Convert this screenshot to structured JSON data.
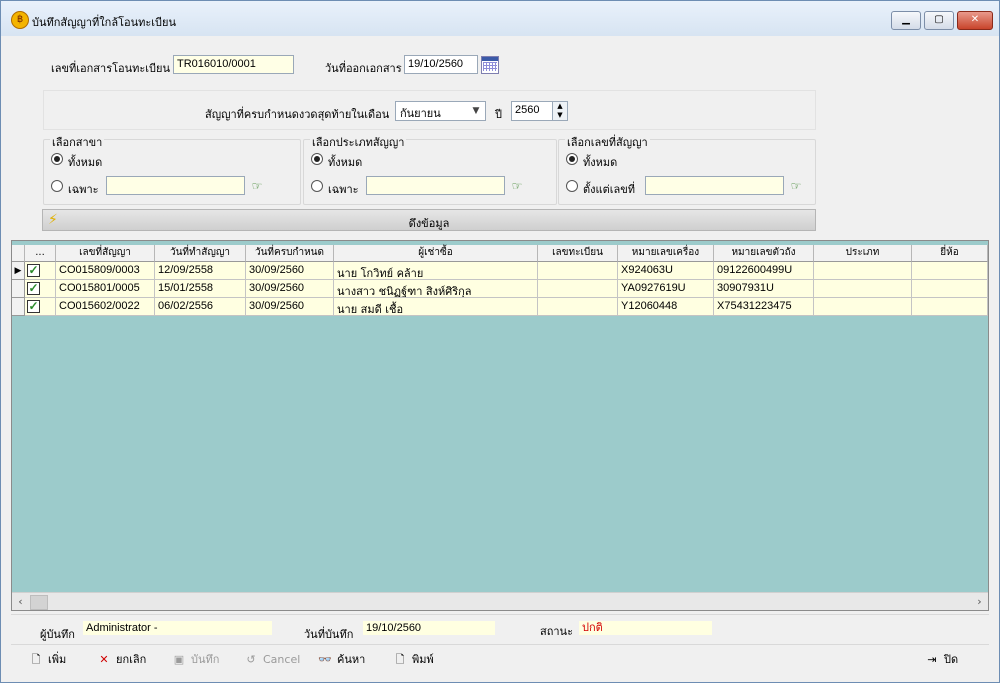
{
  "window": {
    "title": "บันทึกสัญญาที่ใกล้โอนทะเบียน"
  },
  "form": {
    "doc_no_label": "เลขที่เอกสารโอนทะเบียน",
    "doc_no_value": "TR016010/0001",
    "doc_date_label": "วันที่ออกเอกสาร",
    "doc_date_value": "19/10/2560",
    "due_month_label": "สัญญาที่ครบกำหนดงวดสุดท้ายในเดือน",
    "month_value": "กันยายน",
    "year_label": "ปี",
    "year_value": "2560"
  },
  "groups": {
    "branch": {
      "title": "เลือกสาขา",
      "all_label": "ทั้งหมด",
      "specific_label": "เฉพาะ"
    },
    "contract_type": {
      "title": "เลือกประเภทสัญญา",
      "all_label": "ทั้งหมด",
      "specific_label": "เฉพาะ"
    },
    "contract_no": {
      "title": "เลือกเลขที่สัญญา",
      "all_label": "ทั้งหมด",
      "from_label": "ตั้งแต่เลขที่"
    }
  },
  "fetch_button": "ดึงข้อมูล",
  "table": {
    "columns": [
      "...",
      "เลขที่สัญญา",
      "วันที่ทำสัญญา",
      "วันที่ครบกำหนด",
      "ผู้เช่าซื้อ",
      "เลขทะเบียน",
      "หมายเลขเครื่อง",
      "หมายเลขตัวถัง",
      "ประเภท",
      "ยี่ห้อ"
    ],
    "rows": [
      {
        "contract_no": "CO015809/0003",
        "contract_date": "12/09/2558",
        "due_date": "30/09/2560",
        "customer": "นาย โกวิทย์ คล้าย",
        "plate": "",
        "engine_no": "X924063U",
        "chassis_no": "09122600499U",
        "type": "",
        "brand": "",
        "checked": true
      },
      {
        "contract_no": "CO015801/0005",
        "contract_date": "15/01/2558",
        "due_date": "30/09/2560",
        "customer": "นางสาว ชนิฏฐ์ฑา สิงห์ศิริกุล",
        "plate": "",
        "engine_no": "YA0927619U",
        "chassis_no": "30907931U",
        "type": "",
        "brand": "",
        "checked": true
      },
      {
        "contract_no": "CO015602/0022",
        "contract_date": "06/02/2556",
        "due_date": "30/09/2560",
        "customer": "นาย สมดี เชื้อ",
        "plate": "",
        "engine_no": "Y12060448",
        "chassis_no": "X75431223475",
        "type": "",
        "brand": "",
        "checked": true
      }
    ]
  },
  "status": {
    "recorder_label": "ผู้บันทึก",
    "recorder_value": "Administrator -",
    "record_date_label": "วันที่บันทึก",
    "record_date_value": "19/10/2560",
    "state_label": "สถานะ",
    "state_value": "ปกติ",
    "state_color": "#d40000"
  },
  "toolbar": {
    "add": "เพิ่ม",
    "cancel_edit": "ยกเลิก",
    "save": "บันทึก",
    "cancel": "Cancel",
    "search": "ค้นหา",
    "print": "พิมพ์",
    "close": "ปิด"
  }
}
